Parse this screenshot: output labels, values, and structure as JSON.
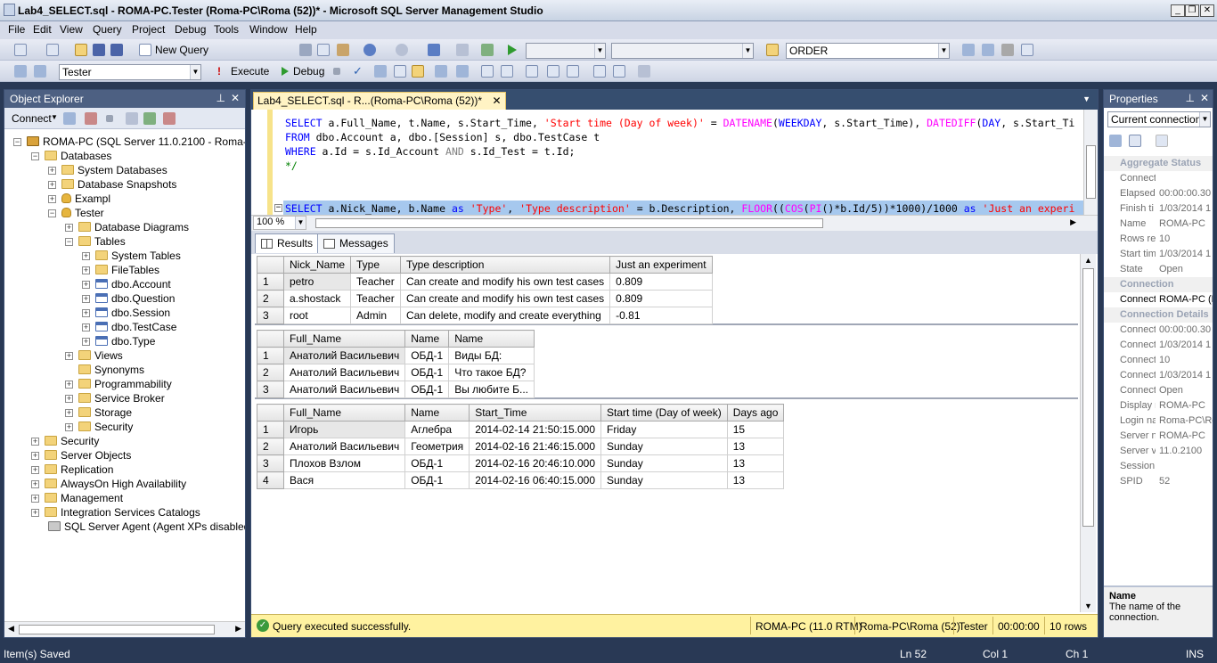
{
  "window": {
    "title": "Lab4_SELECT.sql - ROMA-PC.Tester (Roma-PC\\Roma (52))* - Microsoft SQL Server Management Studio"
  },
  "menu": [
    "File",
    "Edit",
    "View",
    "Query",
    "Project",
    "Debug",
    "Tools",
    "Window",
    "Help"
  ],
  "toolbar1": {
    "new_query": "New Query",
    "search_value": "ORDER"
  },
  "toolbar2": {
    "database": "Tester",
    "execute": "Execute",
    "debug": "Debug"
  },
  "object_explorer": {
    "title": "Object Explorer",
    "connect": "Connect",
    "tree": [
      {
        "label": "ROMA-PC (SQL Server 11.0.2100 - Roma-PC\\R",
        "icon": "server-icon"
      },
      {
        "label": "Databases"
      },
      {
        "label": "System Databases"
      },
      {
        "label": "Database Snapshots"
      },
      {
        "label": "Exampl"
      },
      {
        "label": "Tester"
      },
      {
        "label": "Database Diagrams"
      },
      {
        "label": "Tables"
      },
      {
        "label": "System Tables"
      },
      {
        "label": "FileTables"
      },
      {
        "label": "dbo.Account"
      },
      {
        "label": "dbo.Question"
      },
      {
        "label": "dbo.Session"
      },
      {
        "label": "dbo.TestCase"
      },
      {
        "label": "dbo.Type"
      },
      {
        "label": "Views"
      },
      {
        "label": "Synonyms"
      },
      {
        "label": "Programmability"
      },
      {
        "label": "Service Broker"
      },
      {
        "label": "Storage"
      },
      {
        "label": "Security"
      },
      {
        "label": "Security"
      },
      {
        "label": "Server Objects"
      },
      {
        "label": "Replication"
      },
      {
        "label": "AlwaysOn High Availability"
      },
      {
        "label": "Management"
      },
      {
        "label": "Integration Services Catalogs"
      },
      {
        "label": "SQL Server Agent (Agent XPs disabled)"
      }
    ]
  },
  "editor": {
    "tab": "Lab4_SELECT.sql - R...(Roma-PC\\Roma (52))*",
    "zoom": "100 %"
  },
  "results": {
    "tabs": [
      "Results",
      "Messages"
    ],
    "grid1": {
      "columns": [
        "Nick_Name",
        "Type",
        "Type description",
        "Just an experiment"
      ],
      "rows": [
        [
          "1",
          "petro",
          "Teacher",
          "Can create and modify his own test cases",
          "0.809"
        ],
        [
          "2",
          "a.shostack",
          "Teacher",
          "Can create and modify his own test cases",
          "0.809"
        ],
        [
          "3",
          "root",
          "Admin",
          "Can delete, modify and create everything",
          "-0.81"
        ]
      ]
    },
    "grid2": {
      "columns": [
        "Full_Name",
        "Name",
        "Name"
      ],
      "rows": [
        [
          "1",
          "Анатолий Васильевич",
          "ОБД-1",
          "Виды БД:"
        ],
        [
          "2",
          "Анатолий Васильевич",
          "ОБД-1",
          "Что такое БД?"
        ],
        [
          "3",
          "Анатолий Васильевич",
          "ОБД-1",
          "Вы любите Б..."
        ]
      ]
    },
    "grid3": {
      "columns": [
        "Full_Name",
        "Name",
        "Start_Time",
        "Start time (Day of week)",
        "Days ago"
      ],
      "rows": [
        [
          "1",
          "Игорь",
          "Аглебра",
          "2014-02-14 21:50:15.000",
          "Friday",
          "15"
        ],
        [
          "2",
          "Анатолий Васильевич",
          "Геометрия",
          "2014-02-16 21:46:15.000",
          "Sunday",
          "13"
        ],
        [
          "3",
          "Плохов Взлом",
          "ОБД-1",
          "2014-02-16 20:46:10.000",
          "Sunday",
          "13"
        ],
        [
          "4",
          "Вася",
          "ОБД-1",
          "2014-02-16 06:40:15.000",
          "Sunday",
          "13"
        ]
      ]
    }
  },
  "query_status": {
    "message": "Query executed successfully.",
    "server": "ROMA-PC (11.0 RTM)",
    "user": "Roma-PC\\Roma (52)",
    "db": "Tester",
    "time": "00:00:00",
    "rows": "10 rows"
  },
  "properties": {
    "title": "Properties",
    "selector": "Current connection",
    "cat1": "Aggregate Status",
    "rows1": [
      [
        "Connect",
        ""
      ],
      [
        "Elapsed",
        "00:00:00.30"
      ],
      [
        "Finish ti",
        "1/03/2014 1"
      ],
      [
        "Name",
        "ROMA-PC"
      ],
      [
        "Rows re",
        "10"
      ],
      [
        "Start tim",
        "1/03/2014 1"
      ],
      [
        "State",
        "Open"
      ]
    ],
    "cat2": "Connection",
    "rows2": [
      [
        "Connect",
        "ROMA-PC (R"
      ]
    ],
    "cat3": "Connection Details",
    "rows3": [
      [
        "Connect",
        "00:00:00.30"
      ],
      [
        "Connect",
        "1/03/2014 1"
      ],
      [
        "Connect",
        "10"
      ],
      [
        "Connect",
        "1/03/2014 1"
      ],
      [
        "Connect",
        "Open"
      ],
      [
        "Display n",
        "ROMA-PC"
      ],
      [
        "Login na",
        "Roma-PC\\Ro"
      ],
      [
        "Server n",
        "ROMA-PC"
      ],
      [
        "Server v",
        "11.0.2100"
      ],
      [
        "Session",
        ""
      ],
      [
        "SPID",
        "52"
      ]
    ],
    "desc_title": "Name",
    "desc_text": "The name of the connection."
  },
  "statusbar": {
    "left": "Item(s) Saved",
    "ln": "Ln 52",
    "col": "Col 1",
    "ch": "Ch 1",
    "ins": "INS"
  }
}
